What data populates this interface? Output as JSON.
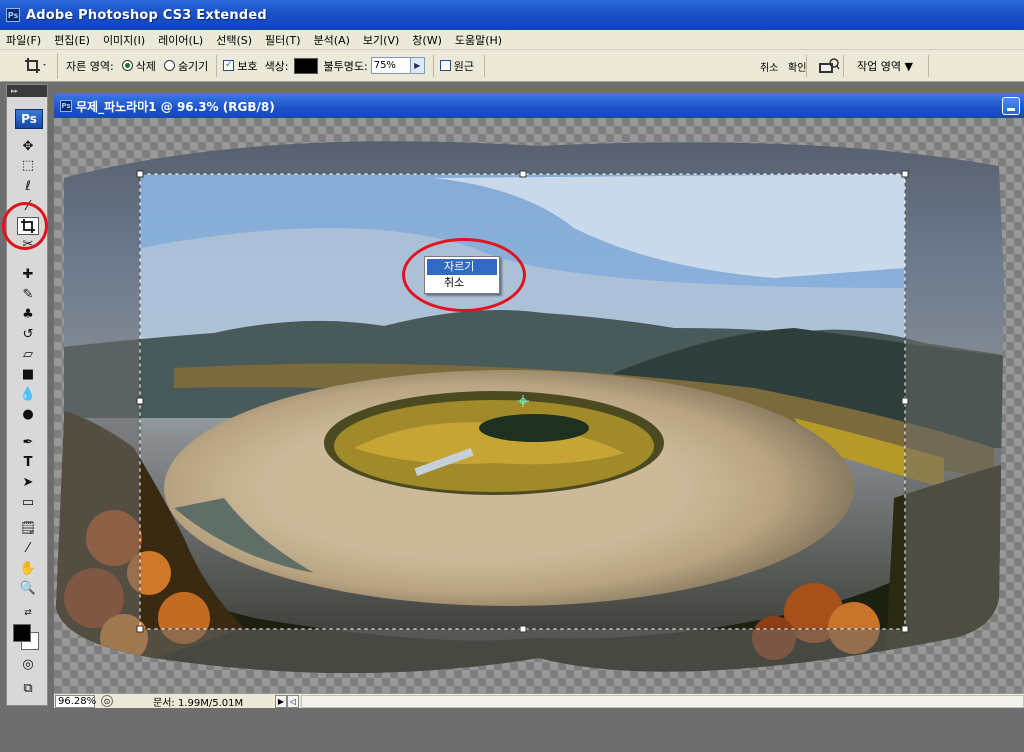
{
  "app": {
    "title": "Adobe Photoshop CS3 Extended",
    "icon": "ps-icon"
  },
  "menu": [
    "파일(F)",
    "편집(E)",
    "이미지(I)",
    "레이어(L)",
    "선택(S)",
    "필터(T)",
    "분석(A)",
    "보기(V)",
    "창(W)",
    "도움말(H)"
  ],
  "options": {
    "crop_area_label": "자른 영역:",
    "delete_label": "삭제",
    "hide_label": "숨기기",
    "delete_selected": true,
    "shield_label": "보호",
    "shield_checked": true,
    "color_label": "색상:",
    "shield_color": "#000000",
    "opacity_label": "불투명도:",
    "opacity_value": "75%",
    "perspective_label": "원근",
    "perspective_checked": false,
    "cancel_label": "취소",
    "confirm_label": "확인",
    "workspace_label": "작업 영역"
  },
  "document": {
    "title": "무제_파노라마1 @ 96.3% (RGB/8)",
    "zoom": "96.28%",
    "doc_info": "문서: 1.99M/5.01M"
  },
  "context_menu": {
    "items": [
      "자르기",
      "취소"
    ],
    "highlighted_index": 0
  },
  "colors": {
    "highlight": "#e0141e",
    "menu_selection": "#316ac5",
    "foreground": "#000000",
    "background": "#ffffff"
  }
}
